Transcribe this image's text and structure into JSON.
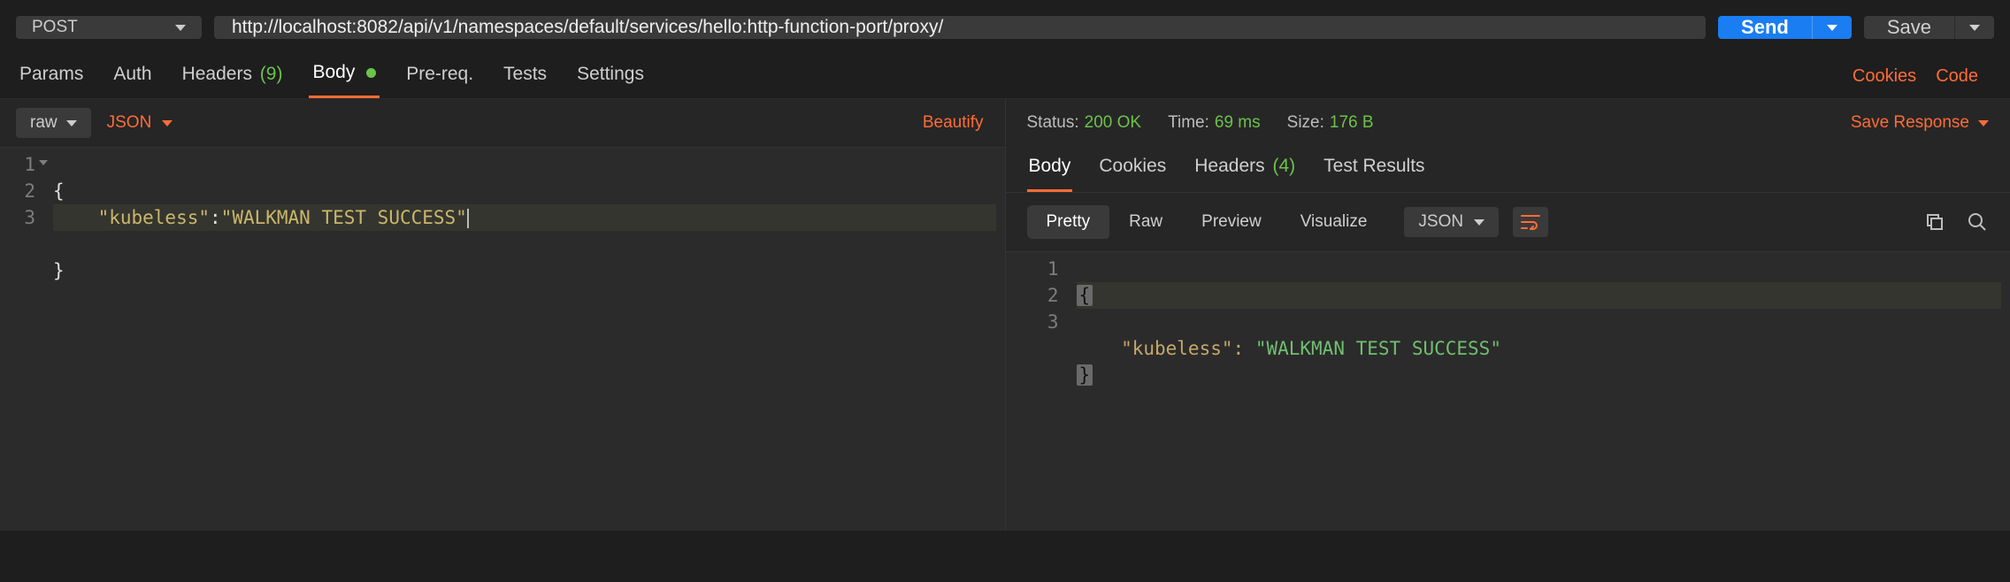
{
  "request": {
    "method": "POST",
    "url": "http://localhost:8082/api/v1/namespaces/default/services/hello:http-function-port/proxy/",
    "send_label": "Send",
    "save_label": "Save"
  },
  "req_tabs": {
    "params": "Params",
    "auth": "Auth",
    "headers": "Headers",
    "headers_count": "(9)",
    "body": "Body",
    "prereq": "Pre-req.",
    "tests": "Tests",
    "settings": "Settings",
    "cookies_link": "Cookies",
    "code_link": "Code"
  },
  "body_bar": {
    "raw_label": "raw",
    "format_label": "JSON",
    "beautify": "Beautify"
  },
  "request_body_lines": {
    "l1": "{",
    "l2_key": "\"kubeless\"",
    "l2_sep": ":",
    "l2_val": "\"WALKMAN TEST SUCCESS\"",
    "l3": "}"
  },
  "response_meta": {
    "status_k": "Status:",
    "status_v": "200 OK",
    "time_k": "Time:",
    "time_v": "69 ms",
    "size_k": "Size:",
    "size_v": "176 B",
    "save_response": "Save Response"
  },
  "resp_tabs": {
    "body": "Body",
    "cookies": "Cookies",
    "headers": "Headers",
    "headers_count": "(4)",
    "test_results": "Test Results"
  },
  "resp_toolbar": {
    "pretty": "Pretty",
    "raw": "Raw",
    "preview": "Preview",
    "visualize": "Visualize",
    "format": "JSON"
  },
  "response_body_lines": {
    "l1": "{",
    "l2_key": "\"kubeless\"",
    "l2_sep": ": ",
    "l2_val": "\"WALKMAN TEST SUCCESS\"",
    "l3": "}"
  }
}
